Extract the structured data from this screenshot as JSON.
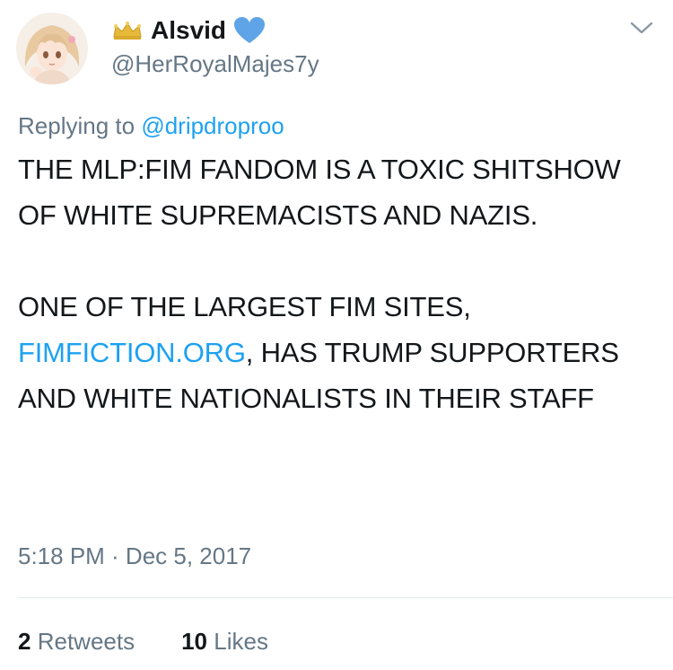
{
  "user": {
    "display_name": "Alsvid",
    "handle": "@HerRoyalMajes7y",
    "crown_icon": "crown-icon",
    "heart_icon": "blue-heart-icon"
  },
  "reply": {
    "prefix": "Replying to",
    "mention": "@dripdroproo"
  },
  "tweet": {
    "line1": "THE MLP:FIM FANDOM IS A TOXIC SHITSHOW OF WHITE SUPREMACISTS AND NAZIS.",
    "line2_before_link": "ONE OF THE LARGEST FIM SITES, ",
    "link_text": "FIMFICTION.ORG",
    "line2_after_link": ", HAS TRUMP SUPPORTERS AND WHITE NATIONALISTS IN THEIR STAFF"
  },
  "meta": {
    "timestamp": "5:18 PM · Dec 5, 2017"
  },
  "stats": {
    "retweets_count": "2",
    "retweets_label": "Retweets",
    "likes_count": "10",
    "likes_label": "Likes"
  },
  "colors": {
    "link": "#1da1f2",
    "muted": "#657786",
    "text": "#14171a",
    "heart": "#5fa4e6",
    "crown": "#e6b93a"
  }
}
